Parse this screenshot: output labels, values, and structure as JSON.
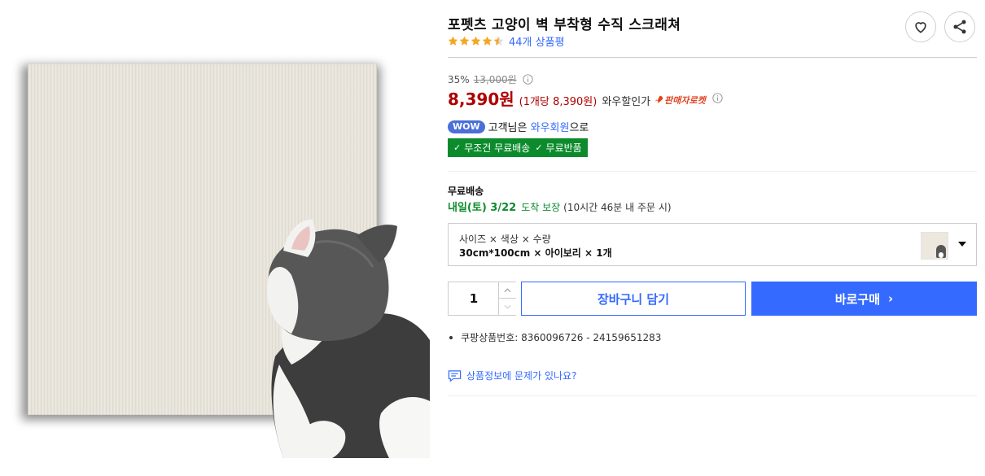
{
  "product": {
    "title": "포펫츠 고양이 벽 부착형 수직 스크래쳐",
    "rating": 4.5,
    "review_count_text": "44개 상품평"
  },
  "actions": {
    "wishlist_icon": "heart-icon",
    "share_icon": "share-icon"
  },
  "price": {
    "discount_rate": "35%",
    "original_price": "13,000원",
    "sale_price": "8,390원",
    "unit_price": "(1개당 8,390원)",
    "wow_discount": "와우할인가",
    "rocket_badge": "판매자로켓"
  },
  "wow": {
    "badge": "WOW",
    "prefix": "고객님은",
    "member_link": "와우회원",
    "suffix": "으로"
  },
  "benefits": [
    "무조건 무료배송",
    "무료반품"
  ],
  "shipping": {
    "title": "무료배송",
    "date": "내일(토) 3/22",
    "guarantee": "도착 보장",
    "note": "(10시간 46분 내 주문 시)"
  },
  "option": {
    "labels": "사이즈 × 색상 × 수량",
    "values": "30cm*100cm × 아이보리 × 1개"
  },
  "quantity": "1",
  "buttons": {
    "cart": "장바구니 담기",
    "buy": "바로구매",
    "buy_chevron": "›"
  },
  "product_number": "쿠팡상품번호: 8360096726 - 24159651283",
  "report_link": "상품정보에 문제가 있나요?",
  "colors": {
    "accent_blue": "#346aff",
    "price_red": "#ae0000",
    "benefit_green": "#0c8b2c",
    "star_orange": "#f5a623"
  }
}
